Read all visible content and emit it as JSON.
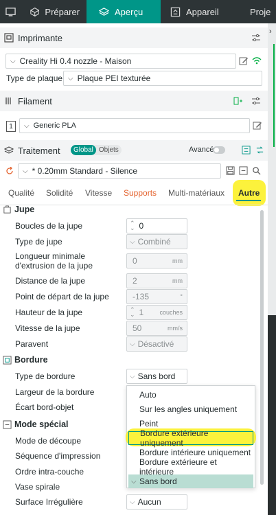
{
  "topbar": {
    "tabs": [
      {
        "label": "Préparer"
      },
      {
        "label": "Aperçu"
      },
      {
        "label": "Appareil"
      },
      {
        "label": "Proje"
      }
    ]
  },
  "printer": {
    "title": "Imprimante",
    "selected": "Creality Hi 0.4 nozzle - Maison",
    "plate_label": "Type de plaque",
    "plate_value": "Plaque PEI texturée"
  },
  "filament": {
    "title": "Filament",
    "slot": "1",
    "selected": "Generic PLA"
  },
  "process": {
    "title": "Traitement",
    "toggle_global": "Global",
    "toggle_objects": "Objets",
    "advanced_label": "Avancé",
    "preset": "* 0.20mm Standard - Silence"
  },
  "tabs": [
    "Qualité",
    "Solidité",
    "Vitesse",
    "Supports",
    "Multi-matériaux",
    "Autre"
  ],
  "skirt": {
    "title": "Jupe",
    "rows": [
      {
        "label": "Boucles de la jupe",
        "value": "0",
        "unit": ""
      },
      {
        "label": "Type de jupe",
        "value": "Combiné",
        "unit": ""
      },
      {
        "label": "Longueur minimale d'extrusion de la jupe",
        "value": "0",
        "unit": "mm"
      },
      {
        "label": "Distance de la jupe",
        "value": "2",
        "unit": "mm"
      },
      {
        "label": "Point de départ de la jupe",
        "value": "-135",
        "unit": "°"
      },
      {
        "label": "Hauteur de la jupe",
        "value": "1",
        "unit": "couches"
      },
      {
        "label": "Vitesse de la jupe",
        "value": "50",
        "unit": "mm/s"
      },
      {
        "label": "Paravent",
        "value": "Désactivé",
        "unit": ""
      }
    ]
  },
  "brim": {
    "title": "Bordure",
    "rows": [
      {
        "label": "Type de bordure",
        "value": "Sans bord"
      },
      {
        "label": "Largeur de la bordure"
      },
      {
        "label": "Écart bord-objet"
      }
    ]
  },
  "special": {
    "title": "Mode spécial",
    "rows": [
      {
        "label": "Mode de découpe"
      },
      {
        "label": "Séquence d'impression"
      },
      {
        "label": "Ordre intra-couche"
      },
      {
        "label": "Vase spirale"
      },
      {
        "label": "Surface Irrégulière",
        "value": "Aucun"
      }
    ]
  },
  "dropdown": {
    "options": [
      "Auto",
      "Sur les angles uniquement",
      "Peint",
      "Bordure extérieure uniquement",
      "Bordure intérieure uniquement",
      "Bordure extérieure et intérieure",
      "Sans bord"
    ],
    "selected": "Sans bord",
    "highlighted": "Bordure extérieure uniquement"
  },
  "colors": {
    "accent": "#009688",
    "highlight": "#fbf01a",
    "support_tab": "#e4622d"
  }
}
